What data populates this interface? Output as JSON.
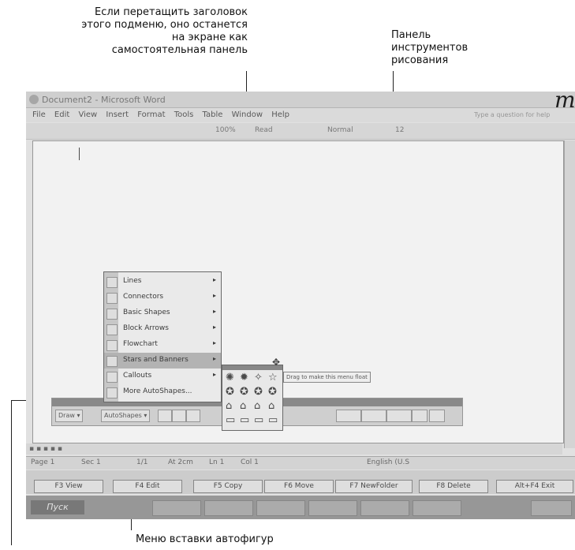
{
  "callouts": {
    "submenu": "Если перетащить заголовок\nэтого подменю, оно останется\nна экране как\nсамостоятельная панель",
    "drawing": "Панель\nинструментов\nрисования",
    "autoshapes": "Меню вставки автофигур"
  },
  "window": {
    "title": "Document2 - Microsoft Word",
    "menu": [
      "File",
      "Edit",
      "View",
      "Insert",
      "Format",
      "Tools",
      "Table",
      "Window",
      "Help"
    ],
    "help_box": "Type a question for help",
    "toolbar": {
      "zoom": "100%",
      "read": "Read",
      "style": "Normal",
      "size": "12"
    },
    "margin_glyph": "m"
  },
  "autoshapes_menu": {
    "items": [
      {
        "label": "Lines",
        "arrow": "▸"
      },
      {
        "label": "Connectors",
        "arrow": "▸"
      },
      {
        "label": "Basic Shapes",
        "arrow": "▸"
      },
      {
        "label": "Block Arrows",
        "arrow": "▸"
      },
      {
        "label": "Flowchart",
        "arrow": "▸"
      },
      {
        "label": "Stars and Banners",
        "arrow": "▸"
      },
      {
        "label": "Callouts",
        "arrow": "▸"
      },
      {
        "label": "More AutoShapes...",
        "arrow": ""
      }
    ],
    "highlighted": "Stars and Banners"
  },
  "submenu": {
    "shapes": [
      "✺",
      "✹",
      "✧",
      "☆",
      "✪",
      "✪",
      "✪",
      "✪",
      "⌂",
      "⌂",
      "⌂",
      "⌂",
      "▭",
      "▭",
      "▭",
      "▭"
    ],
    "tooltip": "Drag to make this menu float"
  },
  "drawing_toolbar": {
    "draw": "Draw ▾",
    "autoshapes": "AutoShapes ▾"
  },
  "status": {
    "page": "Page 1",
    "sec": "Sec 1",
    "pos": "1/1",
    "at": "At 2cm",
    "ln": "Ln 1",
    "col": "Col 1",
    "lang": "English (U.S"
  },
  "fkeys": [
    "F3 View",
    "F4 Edit",
    "F5 Copy",
    "F6 Move",
    "F7 NewFolder",
    "F8 Delete",
    "Alt+F4 Exit"
  ],
  "taskbar": {
    "start": "Пуск"
  }
}
